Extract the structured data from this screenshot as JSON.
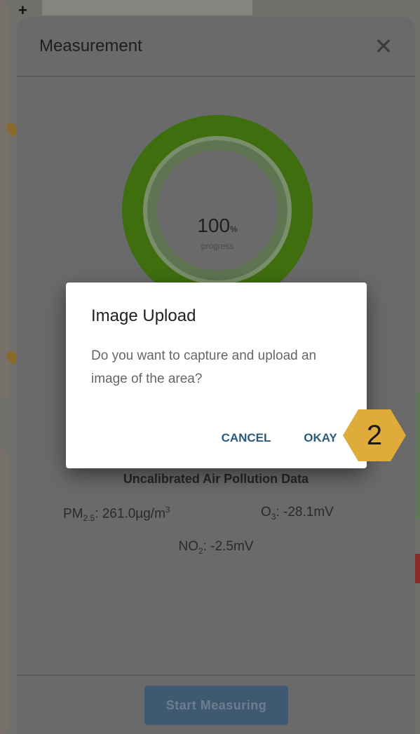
{
  "map": {
    "zoom_in_label": "+"
  },
  "panel": {
    "title": "Measurement",
    "close_label": "✕",
    "progress": {
      "value": "100",
      "unit": "%",
      "label": "progress"
    },
    "data_title": "Uncalibrated Air Pollution Data",
    "readings": {
      "pm25": {
        "name": "PM",
        "sub": "2.5",
        "value": ": 261.0µg/m",
        "sup": "3"
      },
      "o3": {
        "name": "O",
        "sub": "3",
        "value": ": -28.1mV"
      },
      "no2": {
        "name": "NO",
        "sub": "2",
        "value": ": -2.5mV"
      }
    },
    "start_button": "Start Measuring"
  },
  "dialog": {
    "title": "Image Upload",
    "body": "Do you want to capture and upload an image of the area?",
    "cancel": "CANCEL",
    "okay": "OKAY"
  },
  "step_badge": {
    "number": "2",
    "color": "#dfac3c"
  },
  "colors": {
    "ring": "#5fa814",
    "button": "#5b9dd3",
    "dialog_action": "#2b5a7c"
  }
}
